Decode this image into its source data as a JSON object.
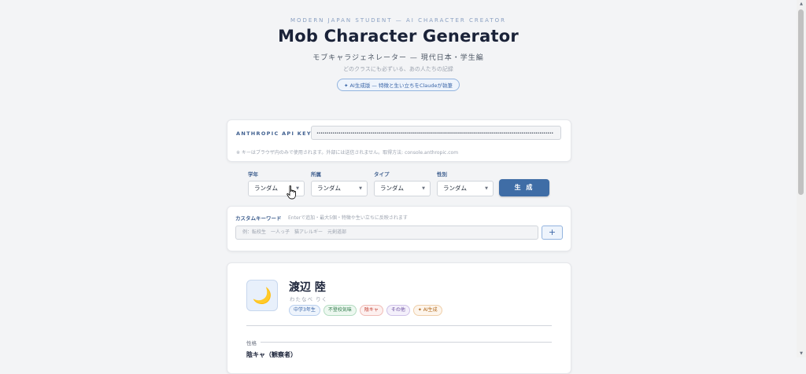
{
  "header": {
    "eyebrow": "MODERN JAPAN STUDENT — AI CHARACTER CREATOR",
    "title": "Mob Character Generator",
    "subtitle": "モブキャラジェネレーター — 現代日本・学生編",
    "tagline": "どのクラスにも必ずいる、あの人たちの記録",
    "ai_badge": "✦ AI生成版 — 特徴と生い立ちをClaudeが執筆"
  },
  "api": {
    "label": "ANTHROPIC API KEY",
    "value": "••••••••••••••••••••••••••••••••••••••••••••••••••••••••••••••••••••••••••••••••••••••••••••••••••••••••••••••••••••••",
    "note": "※ キーはブラウザ内のみで使用されます。外部には送信されません。取得方法: console.anthropic.com"
  },
  "filters": [
    {
      "label": "学年",
      "value": "ランダム"
    },
    {
      "label": "所属",
      "value": "ランダム"
    },
    {
      "label": "タイプ",
      "value": "ランダム"
    },
    {
      "label": "性別",
      "value": "ランダム"
    }
  ],
  "generate_label": "生 成",
  "keywords": {
    "label": "カスタムキーワード",
    "help": "Enterで追加・最大5個・特徴や生い立ちに反映されます",
    "placeholder": "例：転校生　一人っ子　猫アレルギー　元剣道部",
    "add_label": "+"
  },
  "character": {
    "icon": "crescent-moon-icon",
    "avatar_glyph": "🌙",
    "name": "渡辺 陸",
    "kana": "わたなべ りく",
    "tags": [
      {
        "text": "中学3年生",
        "color": "#3b66a8",
        "bg": "#eef4fc",
        "border": "#b9cfee"
      },
      {
        "text": "不登校気味",
        "color": "#2f7a4a",
        "bg": "#edf8f0",
        "border": "#b4dcc1"
      },
      {
        "text": "陰キャ",
        "color": "#c0392b",
        "bg": "#fdf0ef",
        "border": "#f0bcb6"
      },
      {
        "text": "その他",
        "color": "#6b4fa0",
        "bg": "#f4f0fb",
        "border": "#cfc2e8"
      },
      {
        "text": "✦ AI生成",
        "color": "#b36a1e",
        "bg": "#fdf5ec",
        "border": "#efcfaa"
      }
    ],
    "section_label": "性格",
    "personality": "陰キャ（観察者）"
  }
}
